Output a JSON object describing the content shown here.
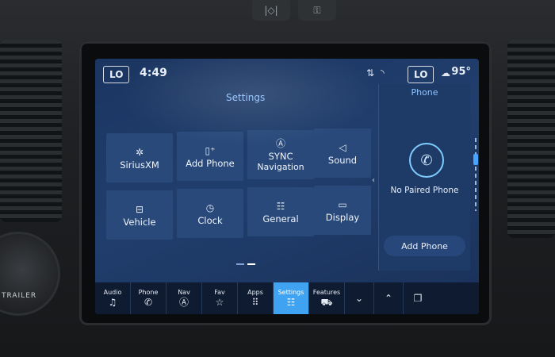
{
  "status_bar": {
    "left_lo": "LO",
    "time": "4:49",
    "right_lo": "LO",
    "temperature": "95°",
    "icons": [
      "data-transfer-icon",
      "wifi-icon",
      "weather-icon"
    ]
  },
  "settings": {
    "title": "Settings",
    "tiles": [
      {
        "label": "SiriusXM",
        "icon": "siriusxm-icon"
      },
      {
        "label": "Add Phone",
        "icon": "add-phone-icon"
      },
      {
        "label": "SYNC",
        "sublabel": "Navigation",
        "icon": "navigation-icon"
      },
      {
        "label": "Sound",
        "icon": "speaker-icon"
      },
      {
        "label": "Vehicle",
        "icon": "vehicle-icon"
      },
      {
        "label": "Clock",
        "icon": "clock-icon"
      },
      {
        "label": "General",
        "icon": "sliders-icon"
      },
      {
        "label": "Display",
        "icon": "display-icon"
      }
    ]
  },
  "phone_panel": {
    "title": "Phone",
    "status": "No Paired Phone",
    "add_button": "Add Phone"
  },
  "bottom_bar": {
    "items": [
      {
        "label": "Audio",
        "icon": "music-note-icon"
      },
      {
        "label": "Phone",
        "icon": "phone-icon"
      },
      {
        "label": "Nav",
        "icon": "navigation-icon"
      },
      {
        "label": "Fav",
        "icon": "star-icon"
      },
      {
        "label": "Apps",
        "icon": "apps-grid-icon"
      },
      {
        "label": "Settings",
        "icon": "sliders-icon",
        "active": true
      },
      {
        "label": "Features",
        "icon": "car-icon"
      }
    ],
    "controls": [
      "chevron-down-icon",
      "chevron-up-icon",
      "copy-icon"
    ]
  },
  "knob": {
    "label": "TRAILER"
  },
  "colors": {
    "accent": "#3fa3f2",
    "tile": "#28497a",
    "screen": "#1d3a66"
  }
}
